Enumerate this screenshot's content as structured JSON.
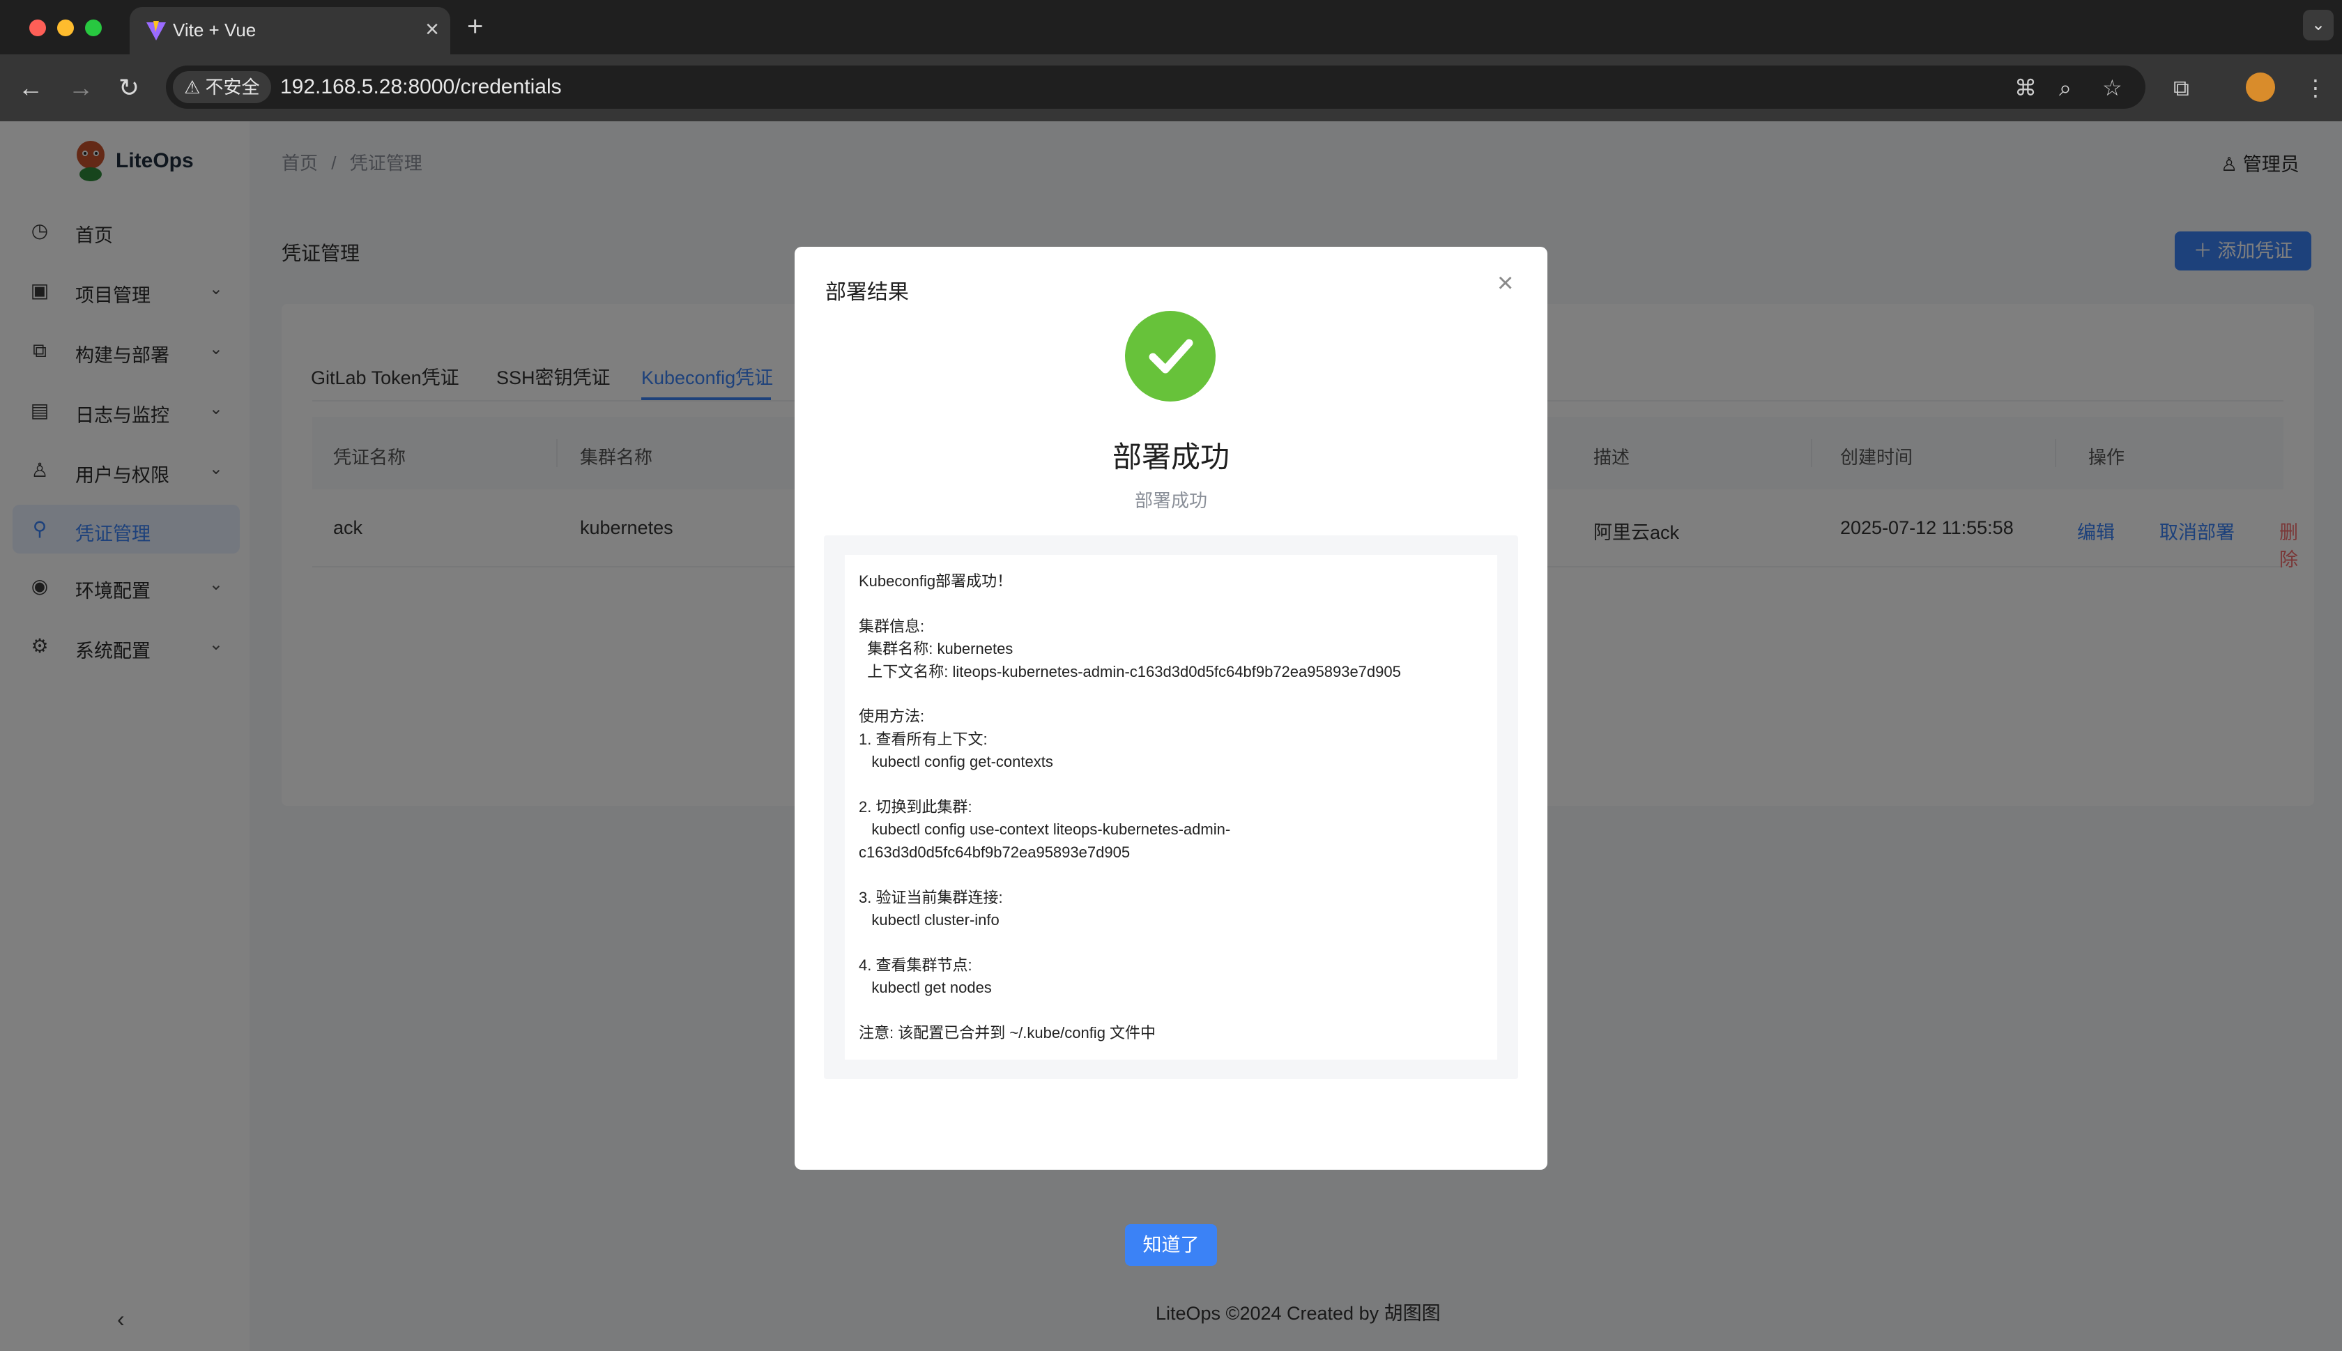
{
  "browser": {
    "tab_title": "Vite + Vue",
    "insecure_label": "不安全",
    "url": "192.168.5.28:8000/credentials"
  },
  "app": {
    "logo_text": "LiteOps",
    "sidebar": {
      "items": [
        {
          "label": "首页",
          "icon": "dashboard-icon",
          "active": false,
          "has_children": false
        },
        {
          "label": "项目管理",
          "icon": "project-icon",
          "active": false,
          "has_children": true
        },
        {
          "label": "构建与部署",
          "icon": "build-icon",
          "active": false,
          "has_children": true
        },
        {
          "label": "日志与监控",
          "icon": "log-icon",
          "active": false,
          "has_children": true
        },
        {
          "label": "用户与权限",
          "icon": "user-icon",
          "active": false,
          "has_children": true
        },
        {
          "label": "凭证管理",
          "icon": "key-icon",
          "active": true,
          "has_children": false
        },
        {
          "label": "环境配置",
          "icon": "environment-icon",
          "active": false,
          "has_children": true
        },
        {
          "label": "系统配置",
          "icon": "settings-icon",
          "active": false,
          "has_children": true
        }
      ]
    },
    "breadcrumb": {
      "home": "首页",
      "separator": "/",
      "current": "凭证管理"
    },
    "user": "管理员",
    "page_title": "凭证管理",
    "add_button": "添加凭证",
    "tabs": [
      {
        "label": "GitLab Token凭证",
        "active": false
      },
      {
        "label": "SSH密钥凭证",
        "active": false
      },
      {
        "label": "Kubeconfig凭证",
        "active": true
      }
    ],
    "table": {
      "headers": [
        "凭证名称",
        "集群名称",
        "描述",
        "创建时间",
        "操作"
      ],
      "rows": [
        {
          "name": "ack",
          "cluster": "kubernetes",
          "description": "阿里云ack",
          "created_at": "2025-07-12 11:55:58",
          "actions": [
            "编辑",
            "取消部署",
            "删除"
          ]
        }
      ]
    },
    "footer": "LiteOps ©2024 Created by 胡图图"
  },
  "modal": {
    "title": "部署结果",
    "result_title": "部署成功",
    "result_subtitle": "部署成功",
    "detail": "Kubeconfig部署成功！\n\n集群信息:\n  集群名称: kubernetes\n  上下文名称: liteops-kubernetes-admin-c163d3d0d5fc64bf9b72ea95893e7d905\n\n使用方法:\n1. 查看所有上下文:\n   kubectl config get-contexts\n\n2. 切换到此集群:\n   kubectl config use-context liteops-kubernetes-admin-\nc163d3d0d5fc64bf9b72ea95893e7d905\n\n3. 验证当前集群连接:\n   kubectl cluster-info\n\n4. 查看集群节点:\n   kubectl get nodes\n\n注意: 该配置已合并到 ~/.kube/config 文件中",
    "confirm_button": "知道了"
  },
  "colors": {
    "primary": "#3b82f6",
    "success": "#67c23a",
    "danger": "#f56c6c"
  }
}
